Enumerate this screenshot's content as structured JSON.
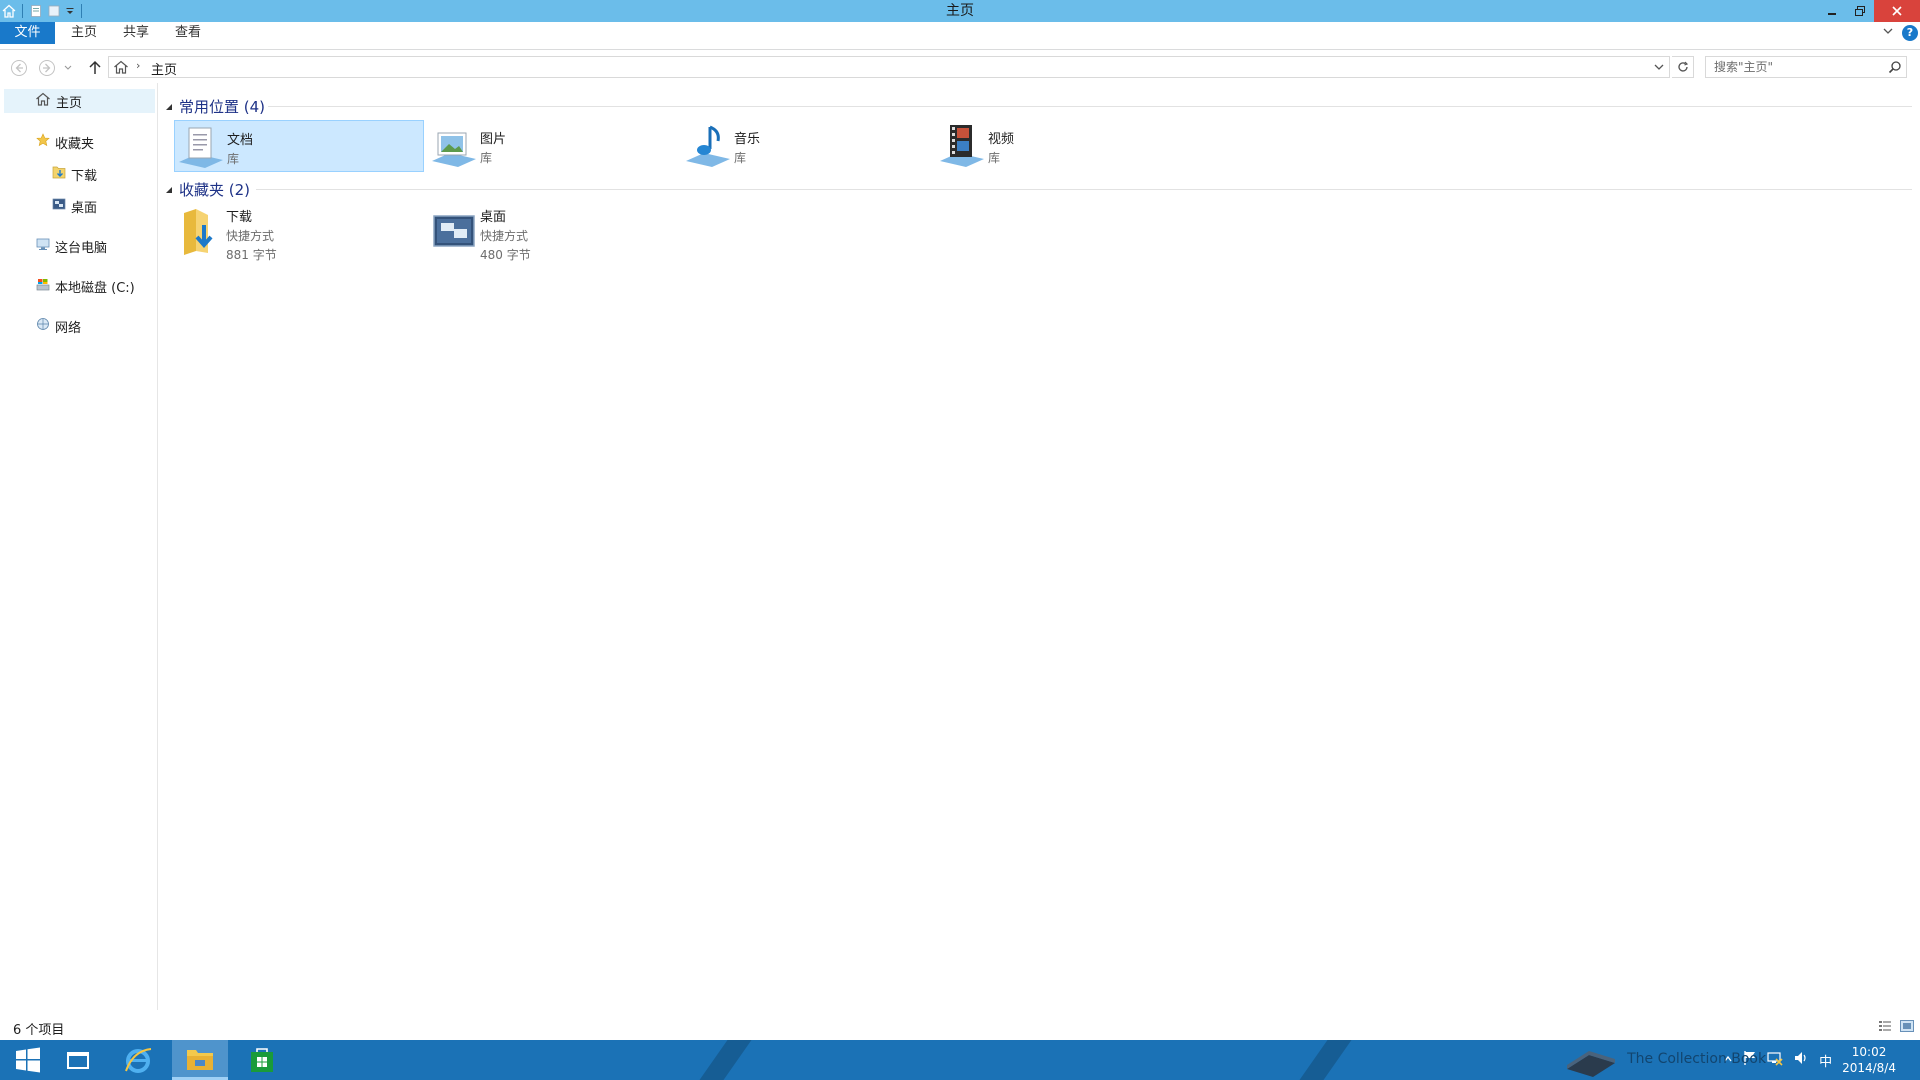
{
  "window": {
    "title": "主页"
  },
  "ribbon": {
    "tabs": [
      {
        "label": "文件"
      },
      {
        "label": "主页"
      },
      {
        "label": "共享"
      },
      {
        "label": "查看"
      }
    ]
  },
  "address": {
    "crumb": "主页"
  },
  "search": {
    "placeholder": "搜索\"主页\""
  },
  "nav": {
    "home": "主页",
    "favorites": "收藏夹",
    "downloads": "下载",
    "desktop": "桌面",
    "thispc": "这台电脑",
    "localdisk": "本地磁盘 (C:)",
    "network": "网络"
  },
  "groups": {
    "frequent": {
      "title": "常用位置 (4)"
    },
    "favorites": {
      "title": "收藏夹 (2)"
    }
  },
  "frequent": [
    {
      "name": "文档",
      "sub": "库",
      "icon": "documents-library-icon"
    },
    {
      "name": "图片",
      "sub": "库",
      "icon": "pictures-library-icon"
    },
    {
      "name": "音乐",
      "sub": "库",
      "icon": "music-library-icon"
    },
    {
      "name": "视频",
      "sub": "库",
      "icon": "videos-library-icon"
    }
  ],
  "favorites": [
    {
      "name": "下载",
      "sub": "快捷方式",
      "size": "881 字节",
      "icon": "downloads-folder-icon"
    },
    {
      "name": "桌面",
      "sub": "快捷方式",
      "size": "480 字节",
      "icon": "desktop-folder-icon"
    }
  ],
  "status": {
    "count": "6 个项目"
  },
  "taskbar": {
    "clock_time": "10:02",
    "clock_date": "2014/8/4",
    "ime": "中",
    "watermark": "The Collection Book"
  },
  "colors": {
    "titlebar": "#6bbdea",
    "accent": "#1979ca",
    "taskbar": "#1b72b6",
    "selection": "#cce8ff",
    "close": "#d9433c"
  }
}
